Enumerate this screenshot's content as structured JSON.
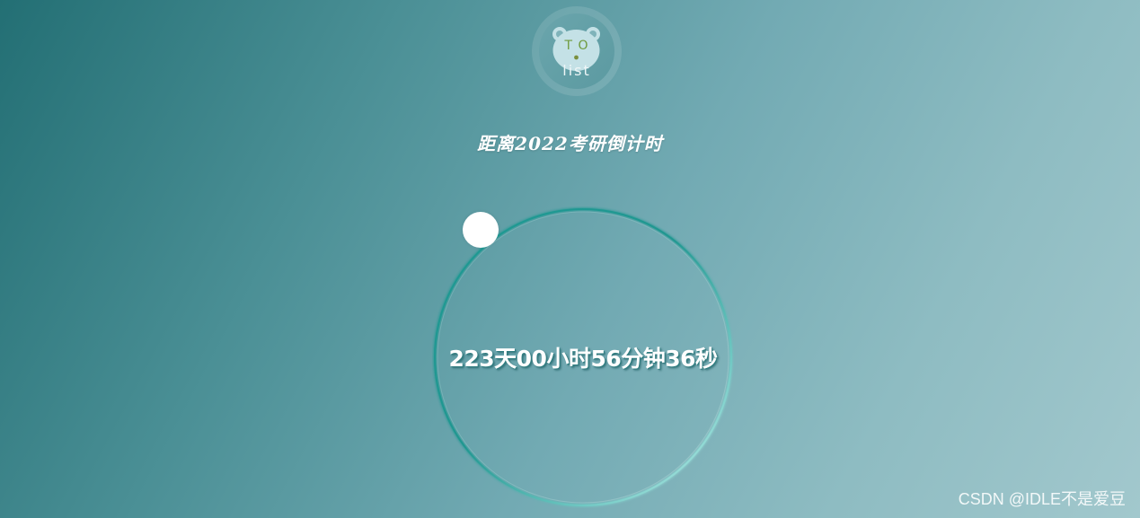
{
  "logo": {
    "icon": "bear-face-icon",
    "text_top": "T O",
    "text_bottom": "list"
  },
  "header": {
    "title": "距离2022考研倒计时"
  },
  "countdown": {
    "display": "223天00小时56分钟36秒",
    "days": "223",
    "hours": "00",
    "minutes": "56",
    "seconds": "36"
  },
  "dial": {
    "icon": "progress-ring-icon",
    "handle": "progress-handle-icon"
  },
  "watermark": {
    "text": "CSDN @IDLE不是爱豆"
  },
  "colors": {
    "ring_accent": "#1d9a93",
    "ring_light": "#b8eeea",
    "background_start": "#236f74",
    "background_end": "#a2c8cd"
  }
}
